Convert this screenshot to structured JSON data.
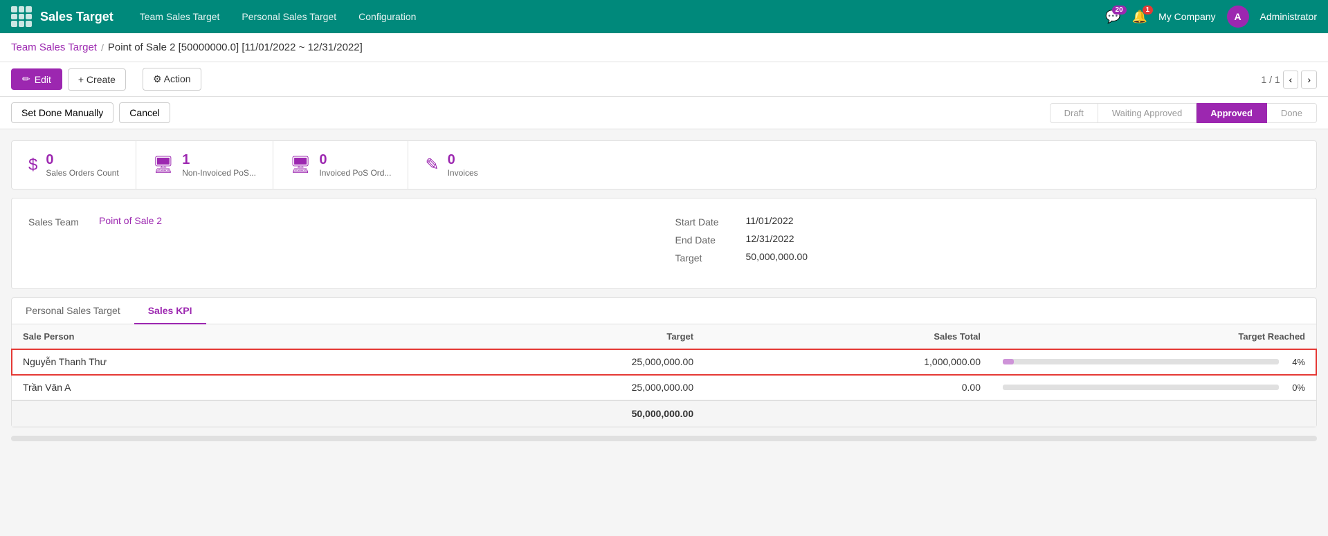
{
  "app": {
    "title": "Sales Target",
    "nav_links": [
      {
        "label": "Team Sales Target",
        "id": "team-sales-target"
      },
      {
        "label": "Personal Sales Target",
        "id": "personal-sales-target"
      },
      {
        "label": "Configuration",
        "id": "configuration"
      }
    ]
  },
  "topbar": {
    "message_count": "20",
    "alert_count": "1",
    "company": "My Company",
    "admin": "Administrator",
    "avatar_letter": "A"
  },
  "breadcrumb": {
    "parent": "Team Sales Target",
    "separator": "/",
    "current": "Point of Sale 2 [50000000.0] [11/01/2022 ~ 12/31/2022]"
  },
  "toolbar": {
    "edit_label": "Edit",
    "create_label": "+ Create",
    "action_label": "⚙ Action",
    "pagination": "1 / 1"
  },
  "status_bar": {
    "set_done_label": "Set Done Manually",
    "cancel_label": "Cancel",
    "steps": [
      {
        "label": "Draft",
        "id": "draft",
        "active": false
      },
      {
        "label": "Waiting Approved",
        "id": "waiting-approved",
        "active": false
      },
      {
        "label": "Approved",
        "id": "approved",
        "active": true
      },
      {
        "label": "Done",
        "id": "done",
        "active": false
      }
    ]
  },
  "stats": [
    {
      "icon": "$",
      "count": "0",
      "label": "Sales Orders Count",
      "id": "sales-orders"
    },
    {
      "icon": "🖥",
      "count": "1",
      "label": "Non-Invoiced PoS...",
      "id": "non-invoiced-pos"
    },
    {
      "icon": "🖥",
      "count": "0",
      "label": "Invoiced PoS Ord...",
      "id": "invoiced-pos"
    },
    {
      "icon": "✎",
      "count": "0",
      "label": "Invoices",
      "id": "invoices"
    }
  ],
  "form": {
    "sales_team_label": "Sales Team",
    "sales_team_value": "Point of Sale 2",
    "start_date_label": "Start Date",
    "start_date_value": "11/01/2022",
    "end_date_label": "End Date",
    "end_date_value": "12/31/2022",
    "target_label": "Target",
    "target_value": "50,000,000.00"
  },
  "tabs": [
    {
      "label": "Personal Sales Target",
      "active": false
    },
    {
      "label": "Sales KPI",
      "active": false
    }
  ],
  "table": {
    "headers": [
      "Sale Person",
      "Target",
      "Sales Total",
      "Target Reached"
    ],
    "rows": [
      {
        "name": "Nguyễn Thanh Thư",
        "target": "25,000,000.00",
        "sales_total": "1,000,000.00",
        "progress": 4,
        "progress_label": "4%",
        "selected": true
      },
      {
        "name": "Trần Văn A",
        "target": "25,000,000.00",
        "sales_total": "0.00",
        "progress": 0,
        "progress_label": "0%",
        "selected": false
      }
    ],
    "total": {
      "label": "",
      "target": "50,000,000.00",
      "sales_total": "",
      "progress_label": ""
    }
  }
}
